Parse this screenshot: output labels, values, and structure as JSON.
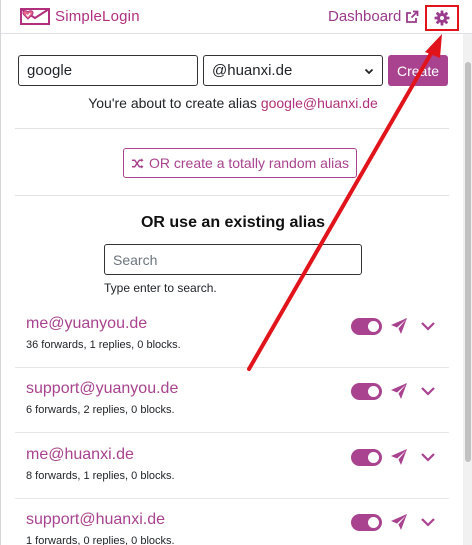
{
  "header": {
    "logo_text": "SimpleLogin",
    "dashboard_label": "Dashboard"
  },
  "create": {
    "prefix_value": "google",
    "suffix_selected": "@huanxi.de",
    "create_label": "Create",
    "about_prefix": "You're about to create alias ",
    "about_alias": "google@huanxi.de"
  },
  "random": {
    "label": "OR create a totally random alias"
  },
  "existing": {
    "title": "OR use an existing alias",
    "search_placeholder": "Search",
    "search_hint": "Type enter to search."
  },
  "aliases": [
    {
      "email": "me@yuanyou.de",
      "stats": "36 forwards, 1 replies, 0 blocks.",
      "enabled": true
    },
    {
      "email": "support@yuanyou.de",
      "stats": "6 forwards, 2 replies, 0 blocks.",
      "enabled": true
    },
    {
      "email": "me@huanxi.de",
      "stats": "8 forwards, 1 replies, 0 blocks.",
      "enabled": true
    },
    {
      "email": "support@huanxi.de",
      "stats": "1 forwards, 0 replies, 0 blocks.",
      "enabled": true
    }
  ],
  "icons": {
    "logo": "simplelogin-logo-icon",
    "external_link": "external-link-icon",
    "settings": "gear-icon",
    "random": "shuffle-icon",
    "send": "send-icon",
    "expand": "chevron-down-icon",
    "select_caret": "caret-down-icon"
  },
  "colors": {
    "brand": "#a9438f",
    "annotation": "#e1141c"
  }
}
